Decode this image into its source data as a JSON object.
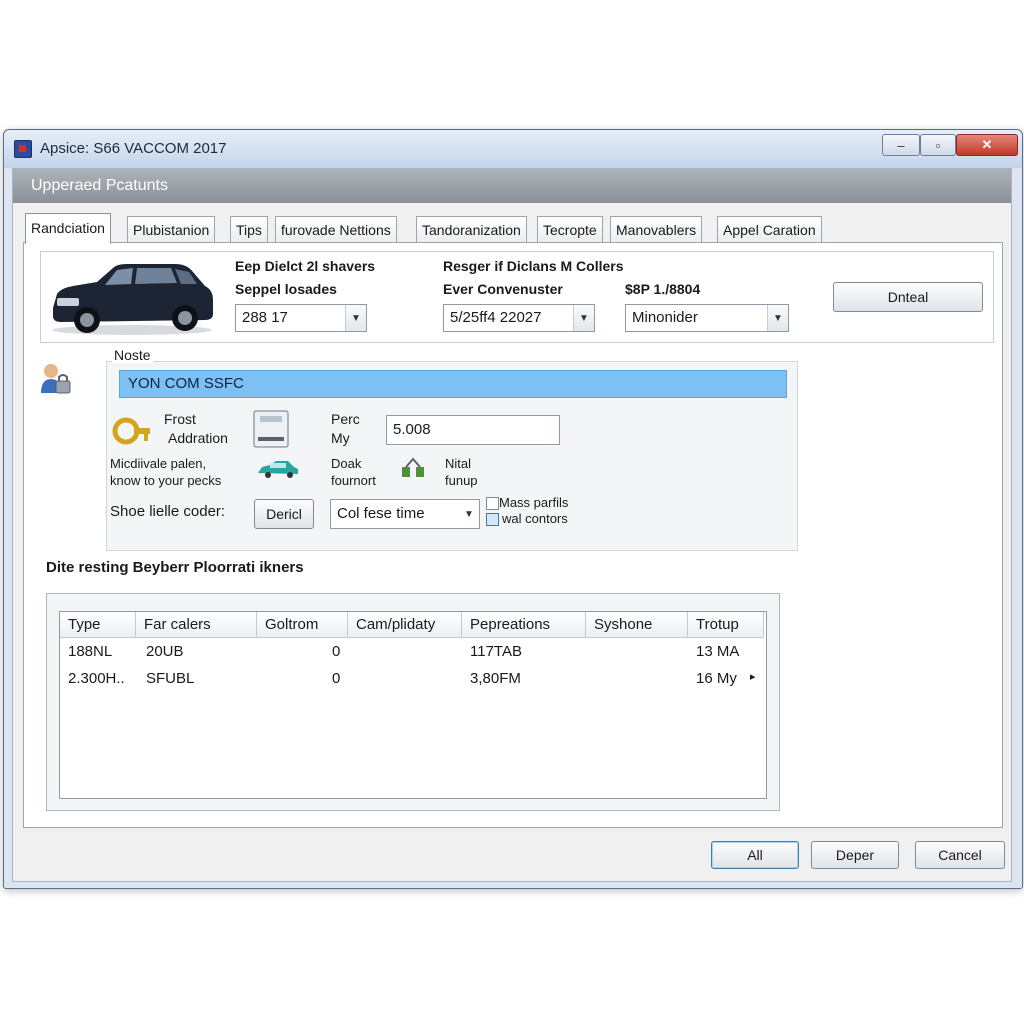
{
  "window": {
    "title": "Apsice: S66 VACCOM 2017",
    "controls": {
      "minimize": "–",
      "maximize": "▫",
      "close": "✕"
    }
  },
  "header": {
    "title": "Upperaed Pcatunts"
  },
  "tabs": [
    {
      "label": "Randciation",
      "active": true
    },
    {
      "label": "Plubistanion",
      "active": false
    },
    {
      "label": "Tips",
      "active": false
    },
    {
      "label": "furovade Nettions",
      "active": false
    },
    {
      "label": "Tandoranization",
      "active": false
    },
    {
      "label": "Tecropte",
      "active": false
    },
    {
      "label": "Manovablers",
      "active": false
    },
    {
      "label": "Appel Caration",
      "active": false
    }
  ],
  "top_group": {
    "field1": {
      "title": "Eep Dielct 2l shavers",
      "label": "Seppel losades",
      "value": "288 17"
    },
    "field2": {
      "title": "Resger if Diclans M Collers",
      "label": "Ever Convenuster",
      "value": "5/25ff4 22027"
    },
    "field3": {
      "label": "$8P 1./8804",
      "value": "Minonider"
    },
    "button": "Dnteal"
  },
  "mode_group": {
    "legend": "Noste",
    "highlight": "YON COM SSFC",
    "frost_label_1": "Frost",
    "frost_label_2": "Addration",
    "per_label_1": "Perc",
    "per_label_2": "My",
    "per_value": "5.008",
    "medivale_1": "Micdiivale palen,",
    "medivale_2": "know to your pecks",
    "doak_1": "Doak",
    "doak_2": "fournort",
    "nital_1": "Nital",
    "nital_2": "funup",
    "shoe_label": "Shoe lielle coder:",
    "deric_button": "Dericl",
    "combo_value": "Col fese time",
    "check1": "Mass parfils",
    "check2": "wal contors"
  },
  "section_title": "Dite resting Beyberr Ploorrati ikners",
  "table": {
    "columns": [
      "Type",
      "Far calers",
      "Goltrom",
      "Cam/plidaty",
      "Pepreations",
      "Syshone",
      "Trotup"
    ],
    "rows": [
      [
        "188NL",
        "20UB",
        "",
        "0",
        "117TAB",
        "",
        "13 MA"
      ],
      [
        "2.300H..",
        "SFUBL",
        "",
        "0",
        "3,80FM",
        "",
        "16 My"
      ]
    ]
  },
  "footer": {
    "all": "All",
    "deper": "Deper",
    "cancel": "Cancel"
  },
  "colors": {
    "highlight": "#7cc0f4",
    "header_band": "#9aa0a6",
    "close_button": "#c0392b"
  }
}
